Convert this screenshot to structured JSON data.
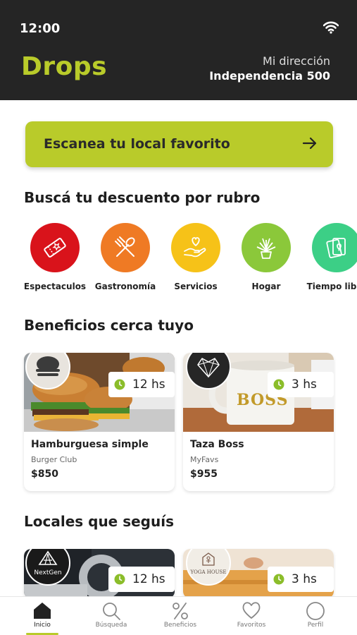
{
  "status": {
    "time": "12:00"
  },
  "header": {
    "brand": "Drops",
    "address_label": "Mi dirección",
    "address_value": "Independencia 500"
  },
  "scan_button": {
    "label": "Escanea tu local favorito"
  },
  "categories_section": {
    "title": "Buscá tu descuento por rubro",
    "items": [
      {
        "label": "Espectaculos",
        "icon": "ticket-icon",
        "color": "#d9131b"
      },
      {
        "label": "Gastronomía",
        "icon": "utensils-icon",
        "color": "#ef7a24"
      },
      {
        "label": "Servicios",
        "icon": "hand-heart-icon",
        "color": "#f6c218"
      },
      {
        "label": "Hogar",
        "icon": "plant-icon",
        "color": "#8bc83a"
      },
      {
        "label": "Tiempo libre",
        "icon": "cards-icon",
        "color": "#3ccf86"
      }
    ]
  },
  "nearby_section": {
    "title": "Beneficios cerca tuyo",
    "cards": [
      {
        "title": "Hamburguesa simple",
        "store": "Burger Club",
        "price": "$850",
        "time": "12 hs",
        "logo_icon": "burger-club-logo"
      },
      {
        "title": "Taza Boss",
        "store": "MyFavs",
        "price": "$955",
        "time": "3 hs",
        "logo_icon": "heart-geometric-logo",
        "mug_text": "BOSS"
      }
    ]
  },
  "following_section": {
    "title": "Locales que seguís",
    "cards": [
      {
        "time": "12 hs",
        "logo_text": "NextGen",
        "logo_icon": "nextgen-logo"
      },
      {
        "time": "3 hs",
        "logo_text": "YOGA HOUSE",
        "logo_icon": "yoga-house-logo"
      }
    ]
  },
  "tabbar": {
    "items": [
      {
        "label": "Inicio",
        "icon": "home-icon",
        "active": true
      },
      {
        "label": "Búsqueda",
        "icon": "search-icon",
        "active": false
      },
      {
        "label": "Beneficios",
        "icon": "percent-icon",
        "active": false
      },
      {
        "label": "Favoritos",
        "icon": "heart-icon",
        "active": false
      },
      {
        "label": "Perfil",
        "icon": "profile-icon",
        "active": false
      }
    ]
  },
  "colors": {
    "accent": "#b9cb2a",
    "header_bg": "#252525",
    "clock_green": "#8bbd2a"
  }
}
